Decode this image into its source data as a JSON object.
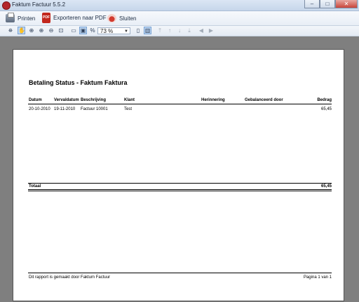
{
  "window": {
    "title": "Faktum Factuur 5.5.2",
    "minimize": "–",
    "maximize": "□",
    "close": "✕"
  },
  "menubar": {
    "print": "Printen",
    "export_pdf": "Exporteren naar PDF",
    "close": "Sluiten"
  },
  "toolbar": {
    "zoom_value": "73 %"
  },
  "report": {
    "title": "Betaling Status - Faktum Faktura",
    "columns": [
      "Datum",
      "Vervaldatum",
      "Beschrijving",
      "Klant",
      "Herinnering",
      "Gebalanceerd door",
      "Bedrag"
    ],
    "rows": [
      {
        "datum": "20-10-2010",
        "vervaldatum": "19-11-2010",
        "beschrijving": "Factuur 10001",
        "klant": "Test",
        "herinnering": "",
        "gebalanceerd": "",
        "bedrag": "65,45"
      }
    ],
    "total_label": "Totaal",
    "total_value": "65,45",
    "footer_left": "Dit rapport is gemaakt door Faktum Factuur",
    "footer_right": "Pagina 1 van 1"
  },
  "colors": {
    "viewer_bg": "#7f7f7f",
    "page_bg": "#ffffff"
  }
}
